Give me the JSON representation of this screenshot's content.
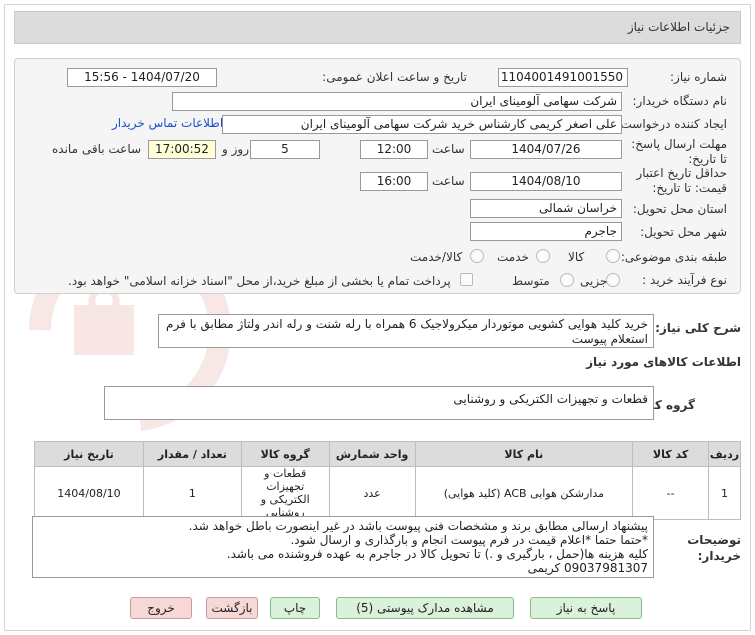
{
  "page_title": "جزئیات اطلاعات نیاز",
  "form": {
    "need_number_label": "شماره نیاز:",
    "need_number": "1104001491001550",
    "announce_label": "تاریخ و ساعت اعلان عمومی:",
    "announce_value": "1404/07/20 - 15:56",
    "buyer_org_label": "نام دستگاه خریدار:",
    "buyer_org": "شرکت سهامی آلومینای ایران",
    "creator_label": "ایجاد کننده درخواست:",
    "creator": "علی اصغر کریمی کارشناس خرید شرکت سهامی آلومینای ایران",
    "contact_link": "اطلاعات تماس خریدار",
    "deadline_label": "مهلت ارسال پاسخ: تا تاریخ:",
    "deadline_date": "1404/07/26",
    "time_label": "ساعت",
    "deadline_time": "12:00",
    "days": "5",
    "days_label": "روز و",
    "remaining_time": "17:00:52",
    "remaining_label": "ساعت باقی مانده",
    "validity_label": "حداقل تاریخ اعتبار قیمت: تا تاریخ:",
    "validity_date": "1404/08/10",
    "validity_time": "16:00",
    "province_label": "استان محل تحویل:",
    "province": "خراسان شمالی",
    "city_label": "شهر محل تحویل:",
    "city": "جاجرم",
    "category_label": "طبقه بندی موضوعی:",
    "category_options": [
      "کالا",
      "خدمت",
      "کالا/خدمت"
    ],
    "process_label": "نوع فرآیند خرید :",
    "process_options": [
      "جزیی",
      "متوسط"
    ],
    "payment_note": "پرداخت تمام یا بخشی از مبلغ خرید،از محل \"اسناد خزانه اسلامی\" خواهد بود."
  },
  "summary": {
    "label": "شرح کلی نیاز:",
    "text": "خرید کلید هوایی کشویی موتوردار میکرولاجیک 6 همراه با رله شنت و رله اندر ولتاژ مطابق با فرم استعلام پیوست"
  },
  "goods_info_title": "اطلاعات کالاهای مورد نیاز",
  "goods_group": {
    "label": "گروه کالا:",
    "value": "قطعات و تجهیزات الکتریکی و روشنایی"
  },
  "table": {
    "headers": [
      "ردیف",
      "کد کالا",
      "نام کالا",
      "واحد شمارش",
      "گروه کالا",
      "تعداد / مقدار",
      "تاریخ نیاز"
    ],
    "rows": [
      [
        "1",
        "--",
        "مدارشکن هوایی ACB (کلید هوایی)",
        "عدد",
        "قطعات و تجهیزات الکتریکی و روشنایی",
        "1",
        "1404/08/10"
      ]
    ]
  },
  "buyer_notes": {
    "label": "توضیحات خریدار:",
    "lines": [
      "پیشنهاد ارسالی مطابق برند و مشخصات فنی پیوست باشد در غیر اینصورت باطل خواهد شد.",
      "*حتما حتما *اعلام قیمت در فرم پیوست انجام و بارگذاری و ارسال شود.",
      "کلیه هزینه ها(حمل ، بارگیری و .) تا تحویل کالا در جاجرم به عهده فروشنده می باشد.",
      "09037981307 کریمی"
    ]
  },
  "buttons": {
    "reply": "پاسخ به نیاز",
    "attachments": "مشاهده مدارک پیوستی (5)",
    "print": "چاپ",
    "back": "بازگشت",
    "exit": "خروج"
  }
}
